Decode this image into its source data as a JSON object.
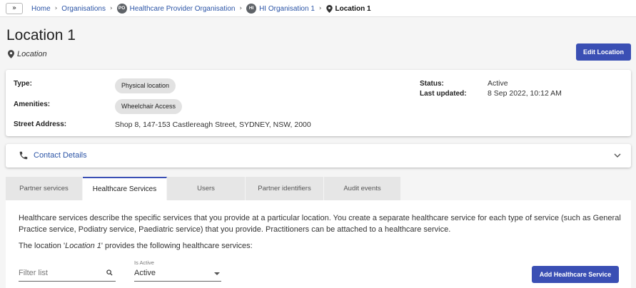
{
  "breadcrumb": {
    "expand_label": "»",
    "home": "Home",
    "organisations": "Organisations",
    "provider_badge": "PO",
    "provider": "Healthcare Provider Organisation",
    "org_badge": "HI",
    "org": "HI Organisation 1",
    "current": "Location 1",
    "separator": "›"
  },
  "header": {
    "title": "Location 1",
    "subtitle": "Location",
    "edit_label": "Edit Location",
    "pin_icon": "map-pin-icon"
  },
  "details": {
    "type_label": "Type:",
    "type_value": "Physical location",
    "amenities_label": "Amenities:",
    "amenities_value": "Wheelchair Access",
    "address_label": "Street Address:",
    "address_value": "Shop 8, 147-153 Castlereagh Street, SYDNEY, NSW, 2000",
    "status_label": "Status:",
    "status_value": "Active",
    "updated_label": "Last updated:",
    "updated_value": "8 Sep 2022, 10:12 AM"
  },
  "contact": {
    "title": "Contact Details",
    "icon": "phone-icon",
    "chevron": "chevron-down-icon"
  },
  "tabs": [
    {
      "label": "Partner services",
      "active": false
    },
    {
      "label": "Healthcare Services",
      "active": true
    },
    {
      "label": "Users",
      "active": false
    },
    {
      "label": "Partner identifiers",
      "active": false
    },
    {
      "label": "Audit events",
      "active": false
    }
  ],
  "panel": {
    "description": "Healthcare services describe the specific services that you provide at a particular location. You create a separate healthcare service for each type of service (such as General Practice service, Podiatry service, Paediatric service) that you provide. Practitioners can be attached to a healthcare service.",
    "provides_prefix": "The location '",
    "provides_name": "Location 1",
    "provides_suffix": "' provides the following healthcare services:",
    "filter_placeholder": "Filter list",
    "is_active_label": "Is Active",
    "is_active_value": "Active",
    "add_label": "Add Healthcare Service"
  },
  "colors": {
    "accent": "#3a4fb4",
    "link": "#2b54a6"
  }
}
